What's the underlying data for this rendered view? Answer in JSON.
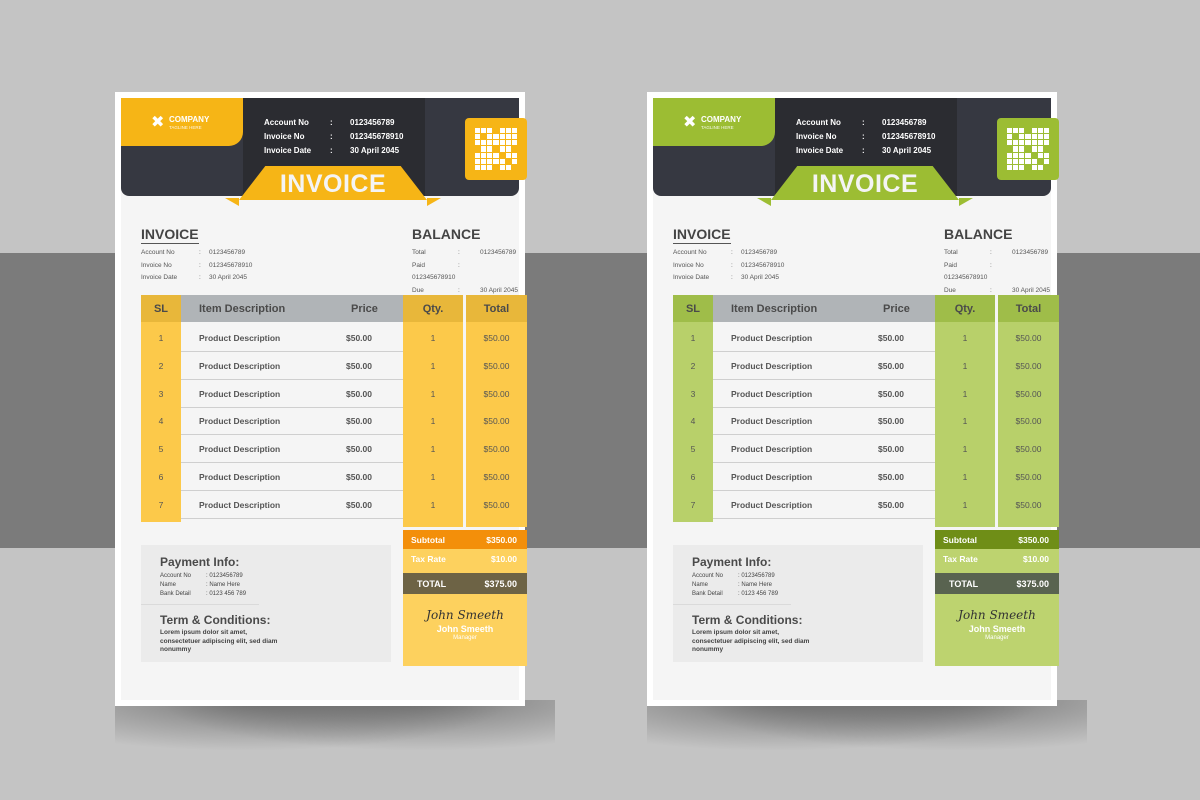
{
  "invoices": [
    {
      "theme": "yellow",
      "colors": {
        "accent": "#f6b516",
        "table_accent": "#fcc94a",
        "header_accent": "#e8b73a",
        "subtotal": "#f38f0a",
        "total_bar": "#6d6345",
        "light": "#fdd15e"
      },
      "company": {
        "name": "COMPANY",
        "tagline": "TAGLINE HERE",
        "logo_icon": "x-logo-icon"
      },
      "header_meta": [
        {
          "label": "Account No",
          "sep": ":",
          "value": "0123456789"
        },
        {
          "label": "Invoice No",
          "sep": ":",
          "value": "012345678910"
        },
        {
          "label": "Invoice Date",
          "sep": ":",
          "value": "30 April 2045"
        }
      ],
      "qr_icon": "qr-code-icon",
      "title": "INVOICE",
      "invoice_section": {
        "title": "INVOICE",
        "rows": [
          {
            "label": "Account No",
            "sep": ":",
            "value": "0123456789"
          },
          {
            "label": "Invoice No",
            "sep": ":",
            "value": "012345678910"
          },
          {
            "label": "Invoice Date",
            "sep": ":",
            "value": "30 April 2045"
          }
        ]
      },
      "balance_section": {
        "title": "BALANCE",
        "rows": [
          {
            "label": "Total",
            "sep": ":",
            "value": "0123456789"
          },
          {
            "label": "Paid",
            "sep": ":",
            "value": "012345678910"
          },
          {
            "label": "Due",
            "sep": ":",
            "value": "30 April 2045"
          }
        ]
      },
      "table": {
        "headers": {
          "sl": "SL",
          "desc": "Item Description",
          "price": "Price",
          "qty": "Qty.",
          "total": "Total"
        },
        "rows": [
          {
            "sl": "1",
            "desc": "Product Description",
            "price": "$50.00",
            "qty": "1",
            "total": "$50.00"
          },
          {
            "sl": "2",
            "desc": "Product Description",
            "price": "$50.00",
            "qty": "1",
            "total": "$50.00"
          },
          {
            "sl": "3",
            "desc": "Product Description",
            "price": "$50.00",
            "qty": "1",
            "total": "$50.00"
          },
          {
            "sl": "4",
            "desc": "Product Description",
            "price": "$50.00",
            "qty": "1",
            "total": "$50.00"
          },
          {
            "sl": "5",
            "desc": "Product Description",
            "price": "$50.00",
            "qty": "1",
            "total": "$50.00"
          },
          {
            "sl": "6",
            "desc": "Product Description",
            "price": "$50.00",
            "qty": "1",
            "total": "$50.00"
          },
          {
            "sl": "7",
            "desc": "Product Description",
            "price": "$50.00",
            "qty": "1",
            "total": "$50.00"
          }
        ]
      },
      "summary": {
        "subtotal_label": "Subtotal",
        "subtotal": "$350.00",
        "tax_label": "Tax Rate",
        "tax": "$10.00",
        "total_label": "TOTAL",
        "total": "$375.00"
      },
      "signature": {
        "script": "John Smeeth",
        "name": "John Smeeth",
        "role": "Manager"
      },
      "payment": {
        "title": "Payment Info:",
        "rows": [
          {
            "label": "Account No",
            "value": ": 0123456789"
          },
          {
            "label": "Name",
            "value": ": Name Here"
          },
          {
            "label": "Bank Detail",
            "value": ": 0123 456 789"
          }
        ]
      },
      "terms": {
        "title": "Term & Conditions:",
        "text": "Lorem ipsum dolor sit amet, consectetuer adipiscing elit, sed diam nonummy"
      }
    },
    {
      "theme": "green",
      "colors": {
        "accent": "#9cbd33",
        "table_accent": "#b8d06a",
        "header_accent": "#9fbd49",
        "subtotal": "#6f8e17",
        "total_bar": "#596350",
        "light": "#bdd36f"
      },
      "company": {
        "name": "COMPANY",
        "tagline": "TAGLINE HERE",
        "logo_icon": "x-logo-icon"
      },
      "header_meta": [
        {
          "label": "Account No",
          "sep": ":",
          "value": "0123456789"
        },
        {
          "label": "Invoice No",
          "sep": ":",
          "value": "012345678910"
        },
        {
          "label": "Invoice Date",
          "sep": ":",
          "value": "30 April 2045"
        }
      ],
      "qr_icon": "qr-code-icon",
      "title": "INVOICE",
      "invoice_section": {
        "title": "INVOICE",
        "rows": [
          {
            "label": "Account No",
            "sep": ":",
            "value": "0123456789"
          },
          {
            "label": "Invoice No",
            "sep": ":",
            "value": "012345678910"
          },
          {
            "label": "Invoice Date",
            "sep": ":",
            "value": "30 April 2045"
          }
        ]
      },
      "balance_section": {
        "title": "BALANCE",
        "rows": [
          {
            "label": "Total",
            "sep": ":",
            "value": "0123456789"
          },
          {
            "label": "Paid",
            "sep": ":",
            "value": "012345678910"
          },
          {
            "label": "Due",
            "sep": ":",
            "value": "30 April 2045"
          }
        ]
      },
      "table": {
        "headers": {
          "sl": "SL",
          "desc": "Item Description",
          "price": "Price",
          "qty": "Qty.",
          "total": "Total"
        },
        "rows": [
          {
            "sl": "1",
            "desc": "Product Description",
            "price": "$50.00",
            "qty": "1",
            "total": "$50.00"
          },
          {
            "sl": "2",
            "desc": "Product Description",
            "price": "$50.00",
            "qty": "1",
            "total": "$50.00"
          },
          {
            "sl": "3",
            "desc": "Product Description",
            "price": "$50.00",
            "qty": "1",
            "total": "$50.00"
          },
          {
            "sl": "4",
            "desc": "Product Description",
            "price": "$50.00",
            "qty": "1",
            "total": "$50.00"
          },
          {
            "sl": "5",
            "desc": "Product Description",
            "price": "$50.00",
            "qty": "1",
            "total": "$50.00"
          },
          {
            "sl": "6",
            "desc": "Product Description",
            "price": "$50.00",
            "qty": "1",
            "total": "$50.00"
          },
          {
            "sl": "7",
            "desc": "Product Description",
            "price": "$50.00",
            "qty": "1",
            "total": "$50.00"
          }
        ]
      },
      "summary": {
        "subtotal_label": "Subtotal",
        "subtotal": "$350.00",
        "tax_label": "Tax Rate",
        "tax": "$10.00",
        "total_label": "TOTAL",
        "total": "$375.00"
      },
      "signature": {
        "script": "John Smeeth",
        "name": "John Smeeth",
        "role": "Manager"
      },
      "payment": {
        "title": "Payment Info:",
        "rows": [
          {
            "label": "Account No",
            "value": ": 0123456789"
          },
          {
            "label": "Name",
            "value": ": Name Here"
          },
          {
            "label": "Bank Detail",
            "value": ": 0123 456 789"
          }
        ]
      },
      "terms": {
        "title": "Term & Conditions:",
        "text": "Lorem ipsum dolor sit amet, consectetuer adipiscing elit, sed diam nonummy"
      }
    }
  ]
}
